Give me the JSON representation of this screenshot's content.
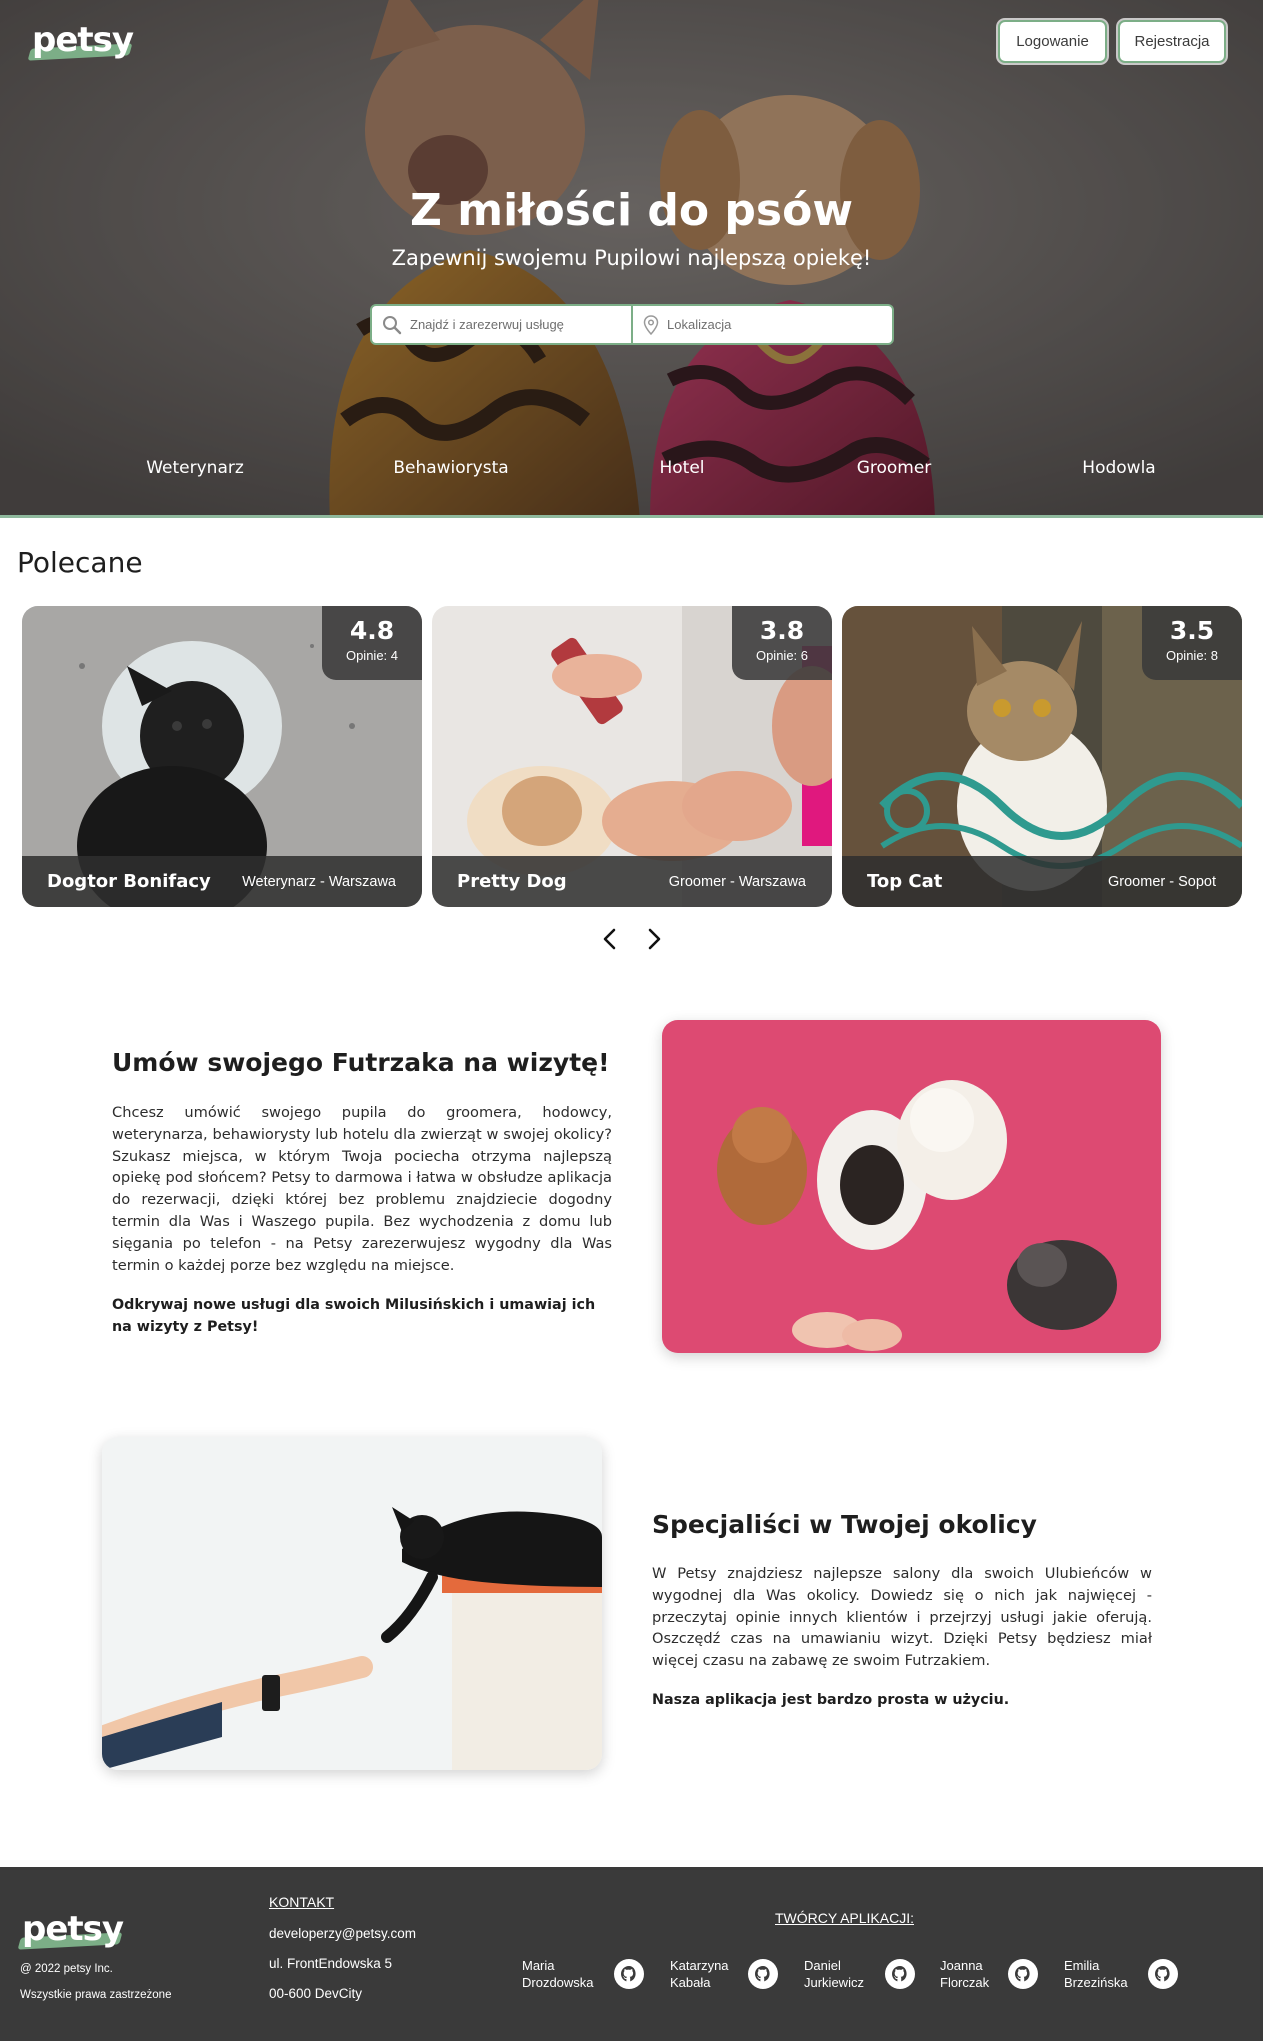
{
  "header": {
    "logo": "petsy",
    "login_label": "Logowanie",
    "register_label": "Rejestracja",
    "title": "Z miłości do psów",
    "subtitle": "Zapewnij swojemu Pupilowi najlepszą opiekę!",
    "search_placeholder": "Znajdź i zarezerwuj usługę",
    "location_placeholder": "Lokalizacja"
  },
  "categories": [
    "Weterynarz",
    "Behawiorysta",
    "Hotel",
    "Groomer",
    "Hodowla"
  ],
  "featured": {
    "title": "Polecane",
    "cards": [
      {
        "rating": "4.8",
        "reviews": "Opinie: 4",
        "name": "Dogtor Bonifacy",
        "meta": "Weterynarz - Warszawa"
      },
      {
        "rating": "3.8",
        "reviews": "Opinie: 6",
        "name": "Pretty Dog",
        "meta": "Groomer - Warszawa"
      },
      {
        "rating": "3.5",
        "reviews": "Opinie: 8",
        "name": "Top Cat",
        "meta": "Groomer - Sopot"
      }
    ]
  },
  "section1": {
    "title": "Umów swojego Futrzaka na wizytę!",
    "text": "Chcesz umówić swojego pupila do groomera, hodowcy, weterynarza, behawiorysty lub hotelu dla zwierząt w swojej okolicy? Szukasz miejsca, w którym Twoja pociecha otrzyma najlepszą opiekę pod słońcem? Petsy to darmowa i łatwa w obsłudze aplikacja do rezerwacji, dzięki której bez problemu znajdziecie dogodny termin dla Was i Waszego pupila. Bez wychodzenia z domu lub sięgania po telefon - na Petsy zarezerwujesz wygodny dla Was termin o każdej porze bez względu na miejsce.",
    "bold": "Odkrywaj nowe usługi dla swoich Milusińskich i umawiaj ich na wizyty z Petsy!"
  },
  "section2": {
    "title": "Specjaliści w Twojej okolicy",
    "text": "W Petsy znajdziesz najlepsze salony dla swoich Ulubieńców w wygodnej dla Was okolicy. Dowiedz się o nich jak najwięcej - przeczytaj opinie innych klientów i przejrzyj usługi jakie oferują. Oszczędź czas na umawianiu wizyt. Dzięki Petsy będziesz miał więcej czasu na zabawę ze swoim Futrzakiem.",
    "bold": "Nasza aplikacja jest bardzo prosta w użyciu."
  },
  "footer": {
    "logo": "petsy",
    "copyright": "@ 2022 petsy Inc.",
    "rights": "Wszystkie prawa zastrzeżone",
    "contact_heading": "KONTAKT",
    "email": "developerzy@petsy.com",
    "street": "ul. FrontEndowska 5",
    "city": "00-600 DevCity",
    "creators_heading": "TWÓRCY APLIKACJI:",
    "creators": [
      "Maria\nDrozdowska",
      "Katarzyna\nKabała",
      "Daniel\nJurkiewicz",
      "Joanna\nFlorczak",
      "Emilia\nBrzezińska"
    ]
  },
  "icons": {
    "search": "search-icon",
    "location": "location-pin-icon",
    "prev": "chevron-left-icon",
    "next": "chevron-right-icon",
    "github": "github-icon"
  },
  "colors": {
    "accent": "#7cae87",
    "footer_bg": "#3a3a3a",
    "overlay": "#3a3a3a"
  }
}
